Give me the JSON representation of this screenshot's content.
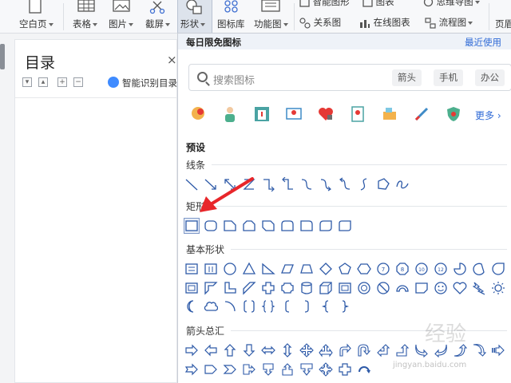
{
  "ribbon": {
    "items": [
      {
        "label": "空白页",
        "has_caret": true
      },
      {
        "label": "表格",
        "has_caret": true
      },
      {
        "label": "图片",
        "has_caret": true
      },
      {
        "label": "截屏",
        "has_caret": true
      },
      {
        "label": "形状",
        "has_caret": true,
        "active": true
      },
      {
        "label": "图标库",
        "has_caret": false
      },
      {
        "label": "功能图",
        "has_caret": true
      }
    ],
    "small_items": [
      {
        "label": "智能图形",
        "icon": "smart-graphic-icon"
      },
      {
        "label": "图表",
        "icon": "chart-icon"
      },
      {
        "label": "思维导图",
        "icon": "mindmap-icon"
      },
      {
        "label": "关系图",
        "icon": "relationship-icon"
      },
      {
        "label": "在线图表",
        "icon": "online-chart-icon"
      },
      {
        "label": "流程图",
        "icon": "flowchart-icon"
      }
    ],
    "right_label": "页眉",
    "accent_color": "#3f6fd1"
  },
  "toc": {
    "title": "目录",
    "close_symbol": "×",
    "smart_label": "智能识别目录"
  },
  "dropdown": {
    "header_title": "每日限免图标",
    "recent_label": "最近使用",
    "search_placeholder": "搜索图标",
    "chips": [
      "箭头",
      "手机",
      "办公"
    ],
    "more_label": "更多",
    "icon_names": [
      "head-icon",
      "doctor-icon",
      "hospital-icon",
      "monitor-icon",
      "heart-icon",
      "clipboard-icon",
      "ward-icon",
      "syringe-icon",
      "shield-icon"
    ],
    "preset_heading": "预设",
    "categories": {
      "lines": "线条",
      "rect": "矩形",
      "basic": "基本形状",
      "arrows": "箭头总汇"
    },
    "selected_shape": "rectangle"
  },
  "annotation": {
    "arrow_color": "#e8262a"
  },
  "watermark": {
    "line1": "经验",
    "line2": "jingyan.baidu.com"
  }
}
